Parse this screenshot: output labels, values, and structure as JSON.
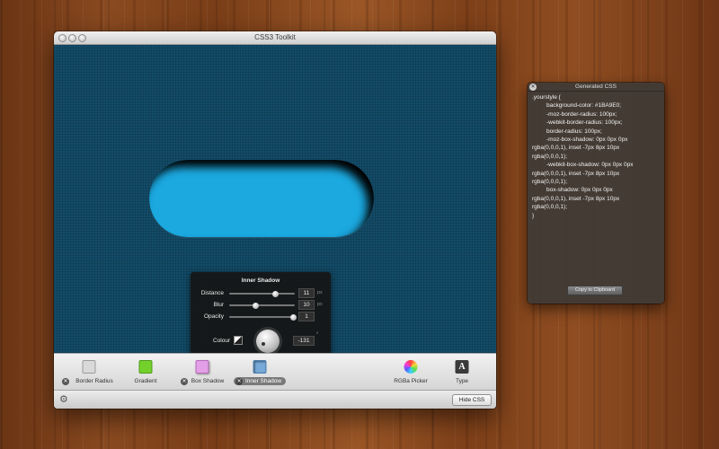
{
  "window": {
    "title": "CSS3 Toolkit"
  },
  "canvas": {
    "shape_color": "#1BA9E0",
    "background_color": "#134c69"
  },
  "popover": {
    "title": "Inner Shadow",
    "controls": [
      {
        "label": "Distance",
        "value": "11",
        "unit": "px",
        "fraction": 0.7
      },
      {
        "label": "Blur",
        "value": "10",
        "unit": "px",
        "fraction": 0.4
      },
      {
        "label": "Opacity",
        "value": "1",
        "unit": "",
        "fraction": 0.98
      }
    ],
    "colour_label": "Colour",
    "angle_value": "-131",
    "angle_unit": "°"
  },
  "toolbar": {
    "items": [
      {
        "label": "Border Radius",
        "icon": "border-radius-icon",
        "color": "#d9d9d9",
        "removable": true,
        "selected": false
      },
      {
        "label": "Gradient",
        "icon": "gradient-icon",
        "color": "#74d12c",
        "removable": false,
        "selected": false
      },
      {
        "label": "Box Shadow",
        "icon": "box-shadow-icon",
        "color": "#e3a0e6",
        "removable": true,
        "selected": false
      },
      {
        "label": "Inner Shadow",
        "icon": "inner-shadow-icon",
        "color": "#78a9d8",
        "removable": true,
        "selected": true
      },
      {
        "label": "RGBa Picker",
        "icon": "color-wheel-icon",
        "color": "",
        "removable": false,
        "selected": false
      },
      {
        "label": "Type",
        "icon": "type-icon",
        "color": "#3a3a3a",
        "removable": false,
        "selected": false
      }
    ],
    "type_glyph": "A"
  },
  "bottombar": {
    "hide_button": "Hide CSS"
  },
  "css_panel": {
    "title": "Generated CSS",
    "code_lines": [
      {
        "text": ".yourstyle {",
        "indent": false
      },
      {
        "text": "background-color: #1BA9E0;",
        "indent": true
      },
      {
        "text": "-moz-border-radius: 100px;",
        "indent": true
      },
      {
        "text": "-webkit-border-radius: 100px;",
        "indent": true
      },
      {
        "text": "border-radius: 100px;",
        "indent": true
      },
      {
        "text": "-moz-box-shadow: 0px 0px 0px",
        "indent": true
      },
      {
        "text": "rgba(0,0,0,1), inset -7px 8px 10px",
        "indent": false
      },
      {
        "text": "rgba(0,0,0,1);",
        "indent": false
      },
      {
        "text": "-webkit-box-shadow: 0px 0px 0px",
        "indent": true
      },
      {
        "text": "rgba(0,0,0,1), inset -7px 8px 10px",
        "indent": false
      },
      {
        "text": "rgba(0,0,0,1);",
        "indent": false
      },
      {
        "text": "box-shadow: 0px 0px 0px",
        "indent": true
      },
      {
        "text": "rgba(0,0,0,1), inset -7px 8px 10px",
        "indent": false
      },
      {
        "text": "rgba(0,0,0,1);",
        "indent": false
      },
      {
        "text": "}",
        "indent": false
      }
    ],
    "copy_button": "Copy to Clipboard"
  }
}
